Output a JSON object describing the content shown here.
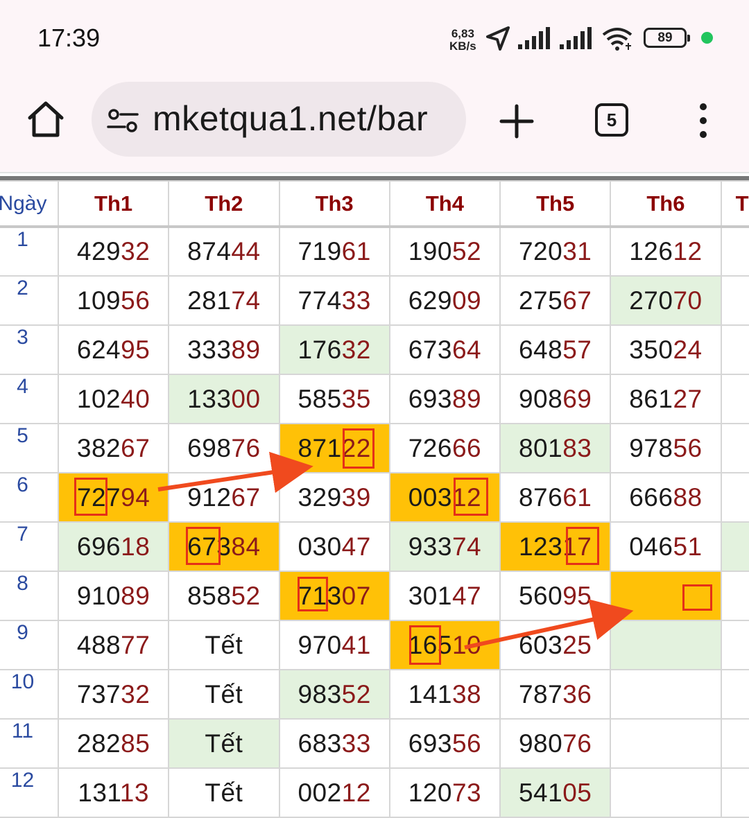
{
  "status_bar": {
    "time": "17:39",
    "net_speed_value": "6,83",
    "net_speed_unit": "KB/s",
    "battery": "89",
    "icons": [
      "location-arrow-icon",
      "signal-icon",
      "signal-icon",
      "wifi-icon",
      "battery-icon"
    ]
  },
  "browser": {
    "url": "mketqua1.net/bar",
    "tab_count": "5",
    "icons": [
      "home-icon",
      "site-info-icon",
      "plus-icon",
      "tabs-icon",
      "more-vert-icon"
    ]
  },
  "table": {
    "headers": [
      "Ngày",
      "Th1",
      "Th2",
      "Th3",
      "Th4",
      "Th5",
      "Th6",
      "T"
    ],
    "rows": [
      {
        "day": "1",
        "cells": [
          {
            "head": "429",
            "tail": "32"
          },
          {
            "head": "874",
            "tail": "44"
          },
          {
            "head": "719",
            "tail": "61"
          },
          {
            "head": "190",
            "tail": "52"
          },
          {
            "head": "720",
            "tail": "31"
          },
          {
            "head": "126",
            "tail": "12"
          }
        ]
      },
      {
        "day": "2",
        "cells": [
          {
            "head": "109",
            "tail": "56"
          },
          {
            "head": "281",
            "tail": "74"
          },
          {
            "head": "774",
            "tail": "33"
          },
          {
            "head": "629",
            "tail": "09"
          },
          {
            "head": "275",
            "tail": "67"
          },
          {
            "head": "270",
            "tail": "70",
            "hl": "green"
          }
        ]
      },
      {
        "day": "3",
        "cells": [
          {
            "head": "624",
            "tail": "95"
          },
          {
            "head": "333",
            "tail": "89"
          },
          {
            "head": "176",
            "tail": "32",
            "hl": "green"
          },
          {
            "head": "673",
            "tail": "64"
          },
          {
            "head": "648",
            "tail": "57"
          },
          {
            "head": "350",
            "tail": "24"
          }
        ]
      },
      {
        "day": "4",
        "cells": [
          {
            "head": "102",
            "tail": "40"
          },
          {
            "head": "133",
            "tail": "00",
            "hl": "green"
          },
          {
            "head": "585",
            "tail": "35"
          },
          {
            "head": "693",
            "tail": "89"
          },
          {
            "head": "908",
            "tail": "69"
          },
          {
            "head": "861",
            "tail": "27"
          }
        ]
      },
      {
        "day": "5",
        "cells": [
          {
            "head": "382",
            "tail": "67"
          },
          {
            "head": "698",
            "tail": "76"
          },
          {
            "head": "871",
            "tail": "22",
            "hl": "orange"
          },
          {
            "head": "726",
            "tail": "66"
          },
          {
            "head": "801",
            "tail": "83",
            "hl": "green"
          },
          {
            "head": "978",
            "tail": "56"
          }
        ]
      },
      {
        "day": "6",
        "cells": [
          {
            "head": "727",
            "tail": "94",
            "hl": "orange"
          },
          {
            "head": "912",
            "tail": "67"
          },
          {
            "head": "329",
            "tail": "39"
          },
          {
            "head": "003",
            "tail": "12",
            "hl": "orange"
          },
          {
            "head": "876",
            "tail": "61"
          },
          {
            "head": "666",
            "tail": "88"
          }
        ]
      },
      {
        "day": "7",
        "cells": [
          {
            "head": "696",
            "tail": "18",
            "hl": "green"
          },
          {
            "head": "673",
            "tail": "84",
            "hl": "orange"
          },
          {
            "head": "030",
            "tail": "47"
          },
          {
            "head": "933",
            "tail": "74",
            "hl": "green"
          },
          {
            "head": "123",
            "tail": "17",
            "hl": "orange"
          },
          {
            "head": "046",
            "tail": "51"
          }
        ]
      },
      {
        "day": "8",
        "cells": [
          {
            "head": "910",
            "tail": "89"
          },
          {
            "head": "858",
            "tail": "52"
          },
          {
            "head": "713",
            "tail": "07",
            "hl": "orange"
          },
          {
            "head": "301",
            "tail": "47"
          },
          {
            "head": "560",
            "tail": "95"
          },
          {
            "head": "",
            "tail": "",
            "hl": "orange"
          }
        ]
      },
      {
        "day": "9",
        "cells": [
          {
            "head": "488",
            "tail": "77"
          },
          {
            "text": "Tết"
          },
          {
            "head": "970",
            "tail": "41"
          },
          {
            "head": "165",
            "tail": "10",
            "hl": "orange"
          },
          {
            "head": "603",
            "tail": "25"
          },
          {
            "head": "",
            "tail": "",
            "hl": "green"
          }
        ]
      },
      {
        "day": "10",
        "cells": [
          {
            "head": "737",
            "tail": "32"
          },
          {
            "text": "Tết"
          },
          {
            "head": "983",
            "tail": "52",
            "hl": "green"
          },
          {
            "head": "141",
            "tail": "38"
          },
          {
            "head": "787",
            "tail": "36"
          },
          {
            "head": "",
            "tail": ""
          }
        ]
      },
      {
        "day": "11",
        "cells": [
          {
            "head": "282",
            "tail": "85"
          },
          {
            "text": "Tết",
            "hl": "green"
          },
          {
            "head": "683",
            "tail": "33"
          },
          {
            "head": "693",
            "tail": "56"
          },
          {
            "head": "980",
            "tail": "76"
          },
          {
            "head": "",
            "tail": ""
          }
        ]
      },
      {
        "day": "12",
        "cells": [
          {
            "head": "131",
            "tail": "13"
          },
          {
            "text": "Tết"
          },
          {
            "head": "002",
            "tail": "12"
          },
          {
            "head": "120",
            "tail": "73"
          },
          {
            "head": "541",
            "tail": "05",
            "hl": "green"
          },
          {
            "head": "",
            "tail": ""
          }
        ]
      }
    ]
  },
  "annotations": {
    "arrow_color": "#f04a1e",
    "box_color": "#e53018",
    "highlight_green": "#e3f2de",
    "highlight_orange": "#ffc107"
  }
}
